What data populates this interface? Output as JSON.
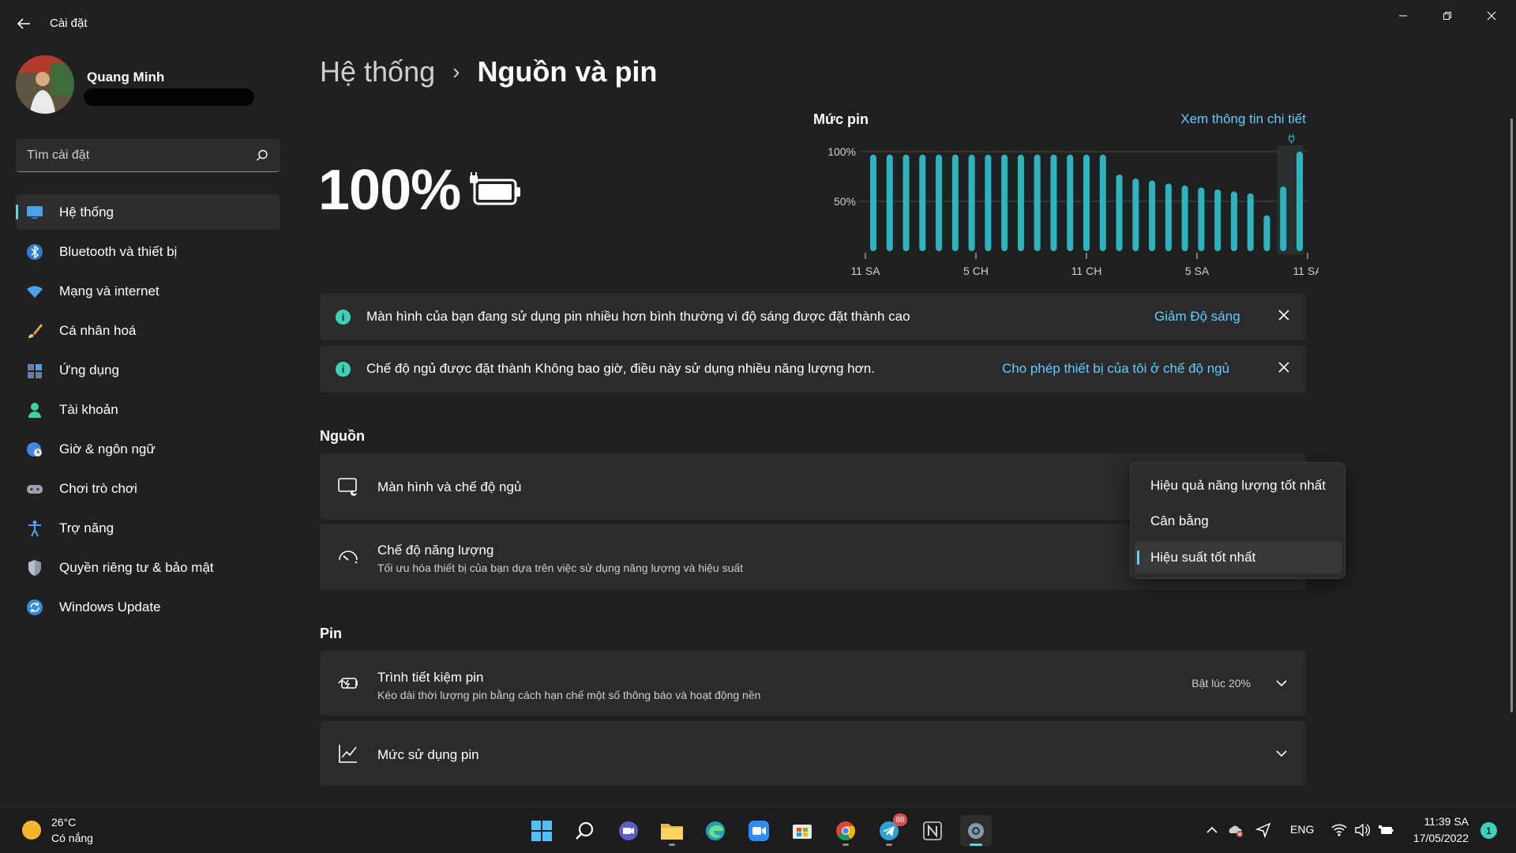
{
  "window": {
    "app_title": "Cài đặt",
    "controls": [
      "minimize-icon",
      "restore-icon",
      "close-icon"
    ]
  },
  "profile": {
    "name": "Quang Minh"
  },
  "search": {
    "placeholder": "Tìm cài đặt"
  },
  "sidebar": {
    "items": [
      {
        "label": "Hệ thống",
        "icon": "monitor-icon",
        "active": true
      },
      {
        "label": "Bluetooth và thiết bị",
        "icon": "bluetooth-icon"
      },
      {
        "label": "Mạng và internet",
        "icon": "wifi-icon"
      },
      {
        "label": "Cá nhân hoá",
        "icon": "brush-icon"
      },
      {
        "label": "Ứng dụng",
        "icon": "apps-icon"
      },
      {
        "label": "Tài khoản",
        "icon": "person-icon"
      },
      {
        "label": "Giờ & ngôn ngữ",
        "icon": "globe-clock-icon"
      },
      {
        "label": "Chơi trò chơi",
        "icon": "gamepad-icon"
      },
      {
        "label": "Trợ năng",
        "icon": "accessibility-icon"
      },
      {
        "label": "Quyền riêng tư & bảo mật",
        "icon": "shield-icon"
      },
      {
        "label": "Windows Update",
        "icon": "update-icon"
      }
    ]
  },
  "breadcrumb": {
    "parent": "Hệ thống",
    "separator": "›",
    "current": "Nguồn và pin"
  },
  "battery": {
    "percent": "100%",
    "charging": true
  },
  "chart_data": {
    "type": "bar",
    "title": "Mức pin",
    "link": "Xem thông tin chi tiết",
    "y_ticks": [
      "100%",
      "50%"
    ],
    "ylim": [
      0,
      100
    ],
    "x_ticks": [
      "11 SA",
      "5 CH",
      "11 CH",
      "5 SA",
      "11 SA"
    ],
    "values": [
      97,
      97,
      97,
      97,
      97,
      97,
      97,
      97,
      97,
      97,
      97,
      97,
      97,
      97,
      97,
      77,
      73,
      71,
      68,
      66,
      64,
      62,
      60,
      58,
      36,
      65,
      100
    ],
    "color": "#2bb5bf",
    "highlight_icon": "plug-icon"
  },
  "notices": [
    {
      "text": "Màn hình của bạn đang sử dụng pin nhiều hơn bình thường vì độ sáng được đặt thành cao",
      "action": "Giảm Độ sáng"
    },
    {
      "text": "Chế độ ngủ được đặt thành Không bao giờ, điều này sử dụng nhiều năng lượng hơn.",
      "action": "Cho phép thiết bị của tôi ở chế độ ngủ"
    }
  ],
  "power_section": {
    "title": "Nguồn",
    "screen_sleep": {
      "title": "Màn hình và chế độ ngủ",
      "icon": "screen-sleep-icon"
    },
    "power_mode": {
      "title": "Chế độ năng lượng",
      "subtitle": "Tối ưu hóa thiết bị của bạn dựa trên việc sử dụng năng lượng và hiệu suất",
      "icon": "gauge-icon"
    }
  },
  "power_mode_dropdown": {
    "options": [
      "Hiệu quả năng lượng tốt nhất",
      "Cân bằng",
      "Hiệu suất tốt nhất"
    ],
    "selected": "Hiệu suất tốt nhất"
  },
  "battery_section": {
    "title": "Pin",
    "saver": {
      "title": "Trình tiết kiệm pin",
      "subtitle": "Kéo dài thời lượng pin bằng cách hạn chế một số thông báo và hoạt động nền",
      "value": "Bật lúc 20%",
      "icon": "battery-saver-icon"
    },
    "usage": {
      "title": "Mức sử dụng pin",
      "icon": "line-chart-icon"
    }
  },
  "taskbar": {
    "weather": {
      "temp": "26°C",
      "desc": "Có nắng"
    },
    "apps": [
      "start-icon",
      "search-icon",
      "chat-icon",
      "file-explorer-icon",
      "edge-icon",
      "zoom-icon",
      "store-icon",
      "chrome-icon",
      "telegram-icon",
      "notion-icon",
      "settings-icon"
    ],
    "telegram_badge": "89",
    "language": "ENG",
    "time": "11:39 SA",
    "date": "17/05/2022",
    "notification_count": "1"
  }
}
